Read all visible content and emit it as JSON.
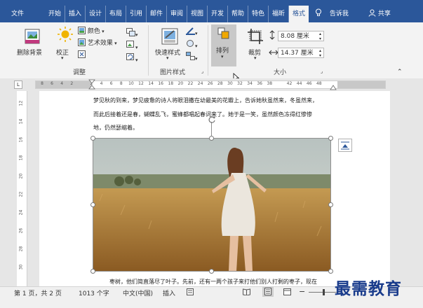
{
  "tabs": [
    {
      "label": "文件"
    },
    {
      "label": "开始"
    },
    {
      "label": "插入"
    },
    {
      "label": "设计"
    },
    {
      "label": "布局"
    },
    {
      "label": "引用"
    },
    {
      "label": "邮件"
    },
    {
      "label": "审阅"
    },
    {
      "label": "视图"
    },
    {
      "label": "开发"
    },
    {
      "label": "帮助"
    },
    {
      "label": "特色"
    },
    {
      "label": "福昕"
    },
    {
      "label": "格式"
    }
  ],
  "tell_me": "告诉我",
  "share": "共享",
  "ribbon": {
    "remove_bg": "删除背景",
    "correct": "校正",
    "color": "颜色",
    "artistic": "艺术效果",
    "group_adjust": "调整",
    "quick_styles": "快速样式",
    "group_picture_styles": "图片样式",
    "arrange": "排列",
    "crop": "裁剪",
    "height_value": "8.08 厘米",
    "width_value": "14.37 厘米",
    "group_size": "大小"
  },
  "ruler": {
    "top_ticks": [
      "8",
      "6",
      "4",
      "2",
      "",
      "2",
      "4",
      "6",
      "8",
      "10",
      "12",
      "14",
      "16",
      "18",
      "20",
      "22",
      "24",
      "26",
      "28",
      "30",
      "32",
      "34",
      "36",
      "38",
      "",
      "42",
      "44",
      "46",
      "48"
    ],
    "left_ticks": [
      "12",
      "14",
      "16",
      "18",
      "20",
      "22",
      "24",
      "26",
      "28",
      "30"
    ]
  },
  "document": {
    "lines": [
      "梦见秋的到来，梦见疲惫的诗人将眼泪撒在幼最美的花瓣上，告诉她秋虽然来，冬虽然来，",
      "而此后接着还是春，蝴蝶乱飞，蜜蜂都唱起春词来了。她于是一笑，虽然颜色冻得红惨惨",
      "地，仍然瑟缩着。"
    ],
    "bottom_line": "枣树，他们简直落尽了叶子。先前，还有一两个孩子来打他们别人打剩的枣子，现在"
  },
  "status": {
    "page": "第 1 页，共 2 页",
    "words": "1013 个字",
    "language": "中文(中国)",
    "mode": "插入"
  },
  "watermark": "最需教育"
}
